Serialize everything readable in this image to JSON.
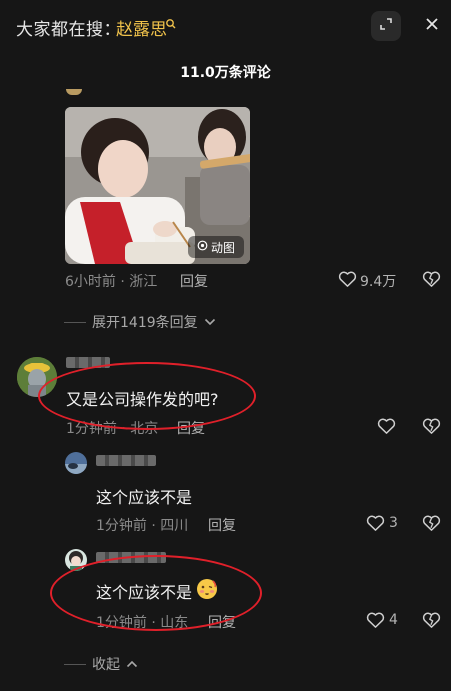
{
  "search": {
    "prefix": "大家都在搜：",
    "keyword": "赵露思"
  },
  "header": {
    "comment_count": "11.0万条评论"
  },
  "top_comment": {
    "gif_badge": "动图",
    "meta": "6小时前 · 浙江",
    "reply_label": "回复",
    "likes": "9.4万",
    "expand_replies": "展开1419条回复"
  },
  "comments": [
    {
      "text": "又是公司操作发的吧?",
      "meta": "1分钟前 · 北京",
      "reply_label": "回复",
      "likes": ""
    },
    {
      "text": "这个应该不是",
      "meta": "1分钟前 · 四川",
      "reply_label": "回复",
      "likes": "3"
    },
    {
      "text": "这个应该不是",
      "meta": "1分钟前 · 山东",
      "reply_label": "回复",
      "likes": "4"
    }
  ],
  "footer": {
    "collapse_label": "收起"
  },
  "colors": {
    "background": "#161616",
    "keyword": "#f0c24b",
    "annotation_red": "#e0202a"
  }
}
